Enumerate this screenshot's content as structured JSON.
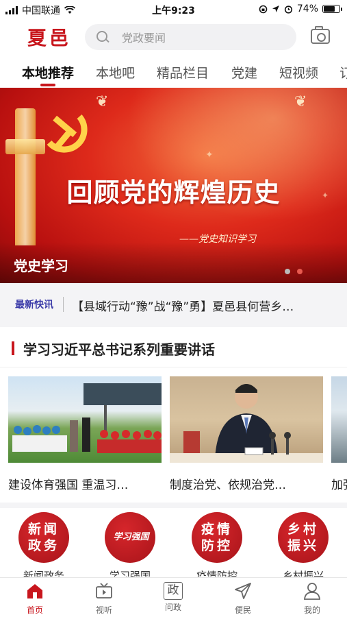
{
  "status_bar": {
    "carrier": "中国联通",
    "time": "上午9:23",
    "battery": "74%",
    "battery_level": 0.74
  },
  "header": {
    "logo": "夏邑",
    "search_placeholder": "党政要闻"
  },
  "tabs": [
    {
      "label": "本地推荐",
      "active": true
    },
    {
      "label": "本地吧"
    },
    {
      "label": "精品栏目"
    },
    {
      "label": "党建"
    },
    {
      "label": "短视频"
    },
    {
      "label": "订"
    }
  ],
  "banner": {
    "headline": "回顾党的辉煌历史",
    "subtitle": "——党史知识学习",
    "caption": "党史学习",
    "slide_count": 2,
    "active_slide": 2
  },
  "flash": {
    "tag": "最新快讯",
    "text": "【县域行动“豫”战“豫”勇】夏邑县何营乡…"
  },
  "section": {
    "title": "学习习近平总书记系列重要讲话"
  },
  "cards": [
    {
      "caption": "建设体育强国 重温习…"
    },
    {
      "caption": "制度治党、依规治党…"
    },
    {
      "caption": "加强"
    }
  ],
  "circles": [
    {
      "icon_text": "新闻政务",
      "label": "新闻政务"
    },
    {
      "icon_text": "学习强国",
      "label": "学习强国"
    },
    {
      "icon_text": "疫情防控",
      "label": "疫情防控"
    },
    {
      "icon_text": "乡村振兴",
      "label": "乡村振兴"
    }
  ],
  "bottom_nav": [
    {
      "label": "首页",
      "icon": "home-icon",
      "active": true
    },
    {
      "label": "视听",
      "icon": "tv-icon"
    },
    {
      "label": "问政",
      "icon": "zheng-icon",
      "icon_text": "政"
    },
    {
      "label": "便民",
      "icon": "send-icon"
    },
    {
      "label": "我的",
      "icon": "user-icon"
    }
  ],
  "colors": {
    "brand_red": "#c8161d",
    "flash_tag": "#3a3aa8"
  }
}
